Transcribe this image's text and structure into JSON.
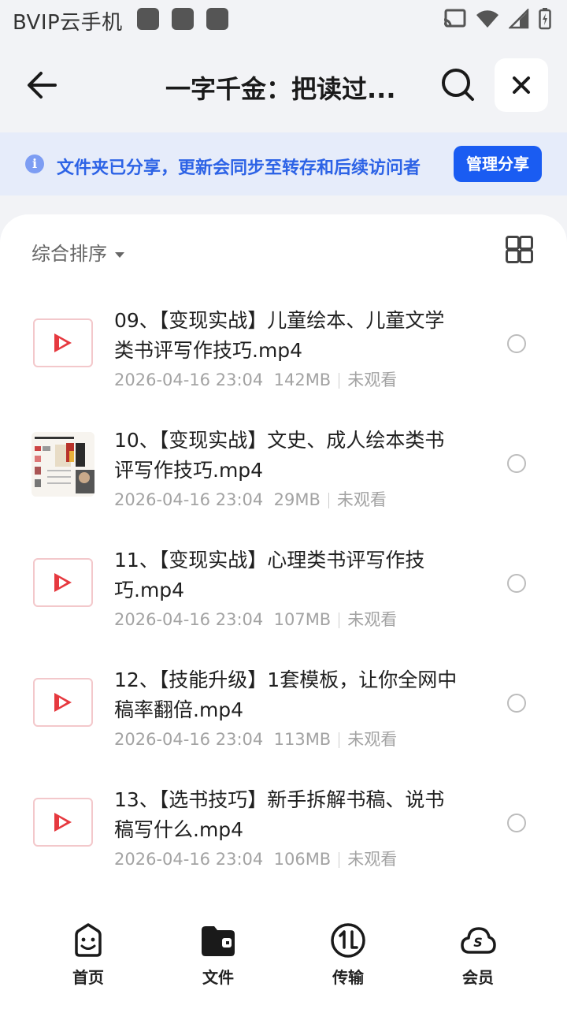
{
  "status_bar": {
    "carrier": "BVIP云手机"
  },
  "header": {
    "title": "一字千金：把读过..."
  },
  "banner": {
    "text": "文件夹已分享，更新会同步至转存和后续访问者",
    "button": "管理分享",
    "accent": "#1a5cf2"
  },
  "sort": {
    "label": "综合排序"
  },
  "files": [
    {
      "name": "09、【变现实战】儿童绘本、儿童文学类书评写作技巧.mp4",
      "date": "2026-04-16 23:04",
      "size": "142MB",
      "status": "未观看",
      "thumb": "video"
    },
    {
      "name": "10、【变现实战】文史、成人绘本类书评写作技巧.mp4",
      "date": "2026-04-16 23:04",
      "size": "29MB",
      "status": "未观看",
      "thumb": "image"
    },
    {
      "name": "11、【变现实战】心理类书评写作技巧.mp4",
      "date": "2026-04-16 23:04",
      "size": "107MB",
      "status": "未观看",
      "thumb": "video"
    },
    {
      "name": "12、【技能升级】1套模板，让你全网中稿率翻倍.mp4",
      "date": "2026-04-16 23:04",
      "size": "113MB",
      "status": "未观看",
      "thumb": "video"
    },
    {
      "name": "13、【选书技巧】新手拆解书稿、说书稿写什么.mp4",
      "date": "2026-04-16 23:04",
      "size": "106MB",
      "status": "未观看",
      "thumb": "video"
    }
  ],
  "nav": [
    {
      "label": "首页",
      "icon": "smile-face-icon"
    },
    {
      "label": "文件",
      "icon": "folder-icon"
    },
    {
      "label": "传输",
      "icon": "transfer-icon"
    },
    {
      "label": "会员",
      "icon": "cloud-s-icon"
    }
  ]
}
